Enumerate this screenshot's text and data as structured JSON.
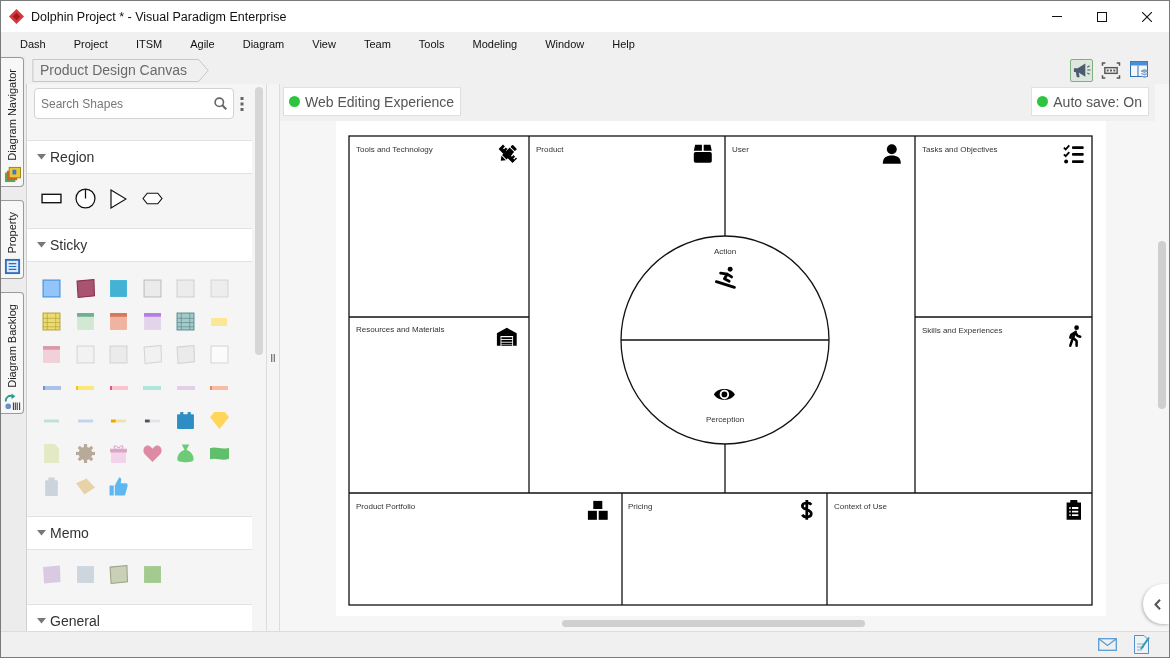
{
  "window": {
    "title": "Dolphin Project * - Visual Paradigm Enterprise"
  },
  "menu": [
    "Dash",
    "Project",
    "ITSM",
    "Agile",
    "Diagram",
    "View",
    "Team",
    "Tools",
    "Modeling",
    "Window",
    "Help"
  ],
  "side_tabs": [
    {
      "kind": "navigator",
      "label": "Diagram Navigator"
    },
    {
      "kind": "property",
      "label": "Property"
    },
    {
      "kind": "backlog",
      "label": "Diagram Backlog"
    }
  ],
  "breadcrumb": [
    "Product Design Canvas"
  ],
  "toolbar": [
    {
      "kind": "megaphone",
      "selected": true
    },
    {
      "kind": "frame",
      "selected": false
    },
    {
      "kind": "layout",
      "selected": false
    }
  ],
  "shape_panel": {
    "search": {
      "placeholder": "Search Shapes"
    },
    "sections": [
      {
        "kind": "region",
        "title": "Region",
        "expanded": true
      },
      {
        "kind": "sticky",
        "title": "Sticky",
        "expanded": true
      },
      {
        "kind": "memo",
        "title": "Memo",
        "expanded": true
      },
      {
        "kind": "general",
        "title": "General",
        "expanded": true
      }
    ]
  },
  "canvas": {
    "web_editing": {
      "label": "Web Editing Experience",
      "on": true
    },
    "auto_save": {
      "label": "Auto save: On",
      "on": true
    }
  },
  "diagram": {
    "blocks": [
      {
        "kind": "tools",
        "title": "Tools and Technology"
      },
      {
        "kind": "product",
        "title": "Product"
      },
      {
        "kind": "user",
        "title": "User"
      },
      {
        "kind": "tasks",
        "title": "Tasks and Objectives"
      },
      {
        "kind": "resources",
        "title": "Resources and Materials"
      },
      {
        "kind": "skills",
        "title": "Skills and Experiences"
      },
      {
        "kind": "portfolio",
        "title": "Product Portfolio"
      },
      {
        "kind": "pricing",
        "title": "Pricing"
      },
      {
        "kind": "context",
        "title": "Context of Use"
      }
    ],
    "circle": {
      "top": "Action",
      "bottom": "Perception"
    }
  }
}
